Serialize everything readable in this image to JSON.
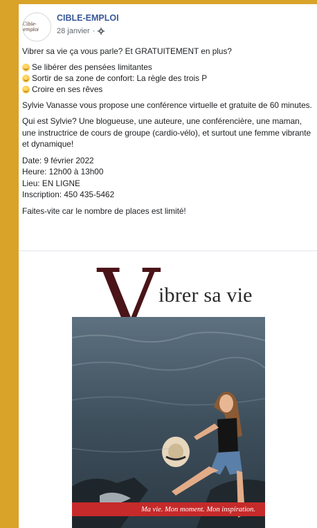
{
  "post": {
    "page_name": "CIBLE-EMPLOI",
    "avatar_text": "Cible-emploi",
    "date": "28 janvier",
    "separator": "·",
    "intro": "Vibrer sa vie ça vous parle? Et GRATUITEMENT en plus?",
    "bullets": [
      "Se libérer des pensées limitantes",
      "Sortir de sa zone de confort: La règle des trois P",
      "Croire en ses rêves"
    ],
    "para1": "Sylvie Vanasse vous propose une conférence virtuelle et gratuite de 60 minutes.",
    "para2": "Qui est Sylvie? Une blogueuse, une auteure, une conférencière, une maman, une instructrice de cours de groupe (cardio-vélo), et surtout une femme vibrante et dynamique!",
    "details": [
      "Date: 9 février 2022",
      "Heure: 12h00 à 13h00",
      "Lieu: EN LIGNE",
      "Inscription: 450 435-5462"
    ],
    "closing": "Faites-vite car le nombre de places est limité!"
  },
  "poster": {
    "title_initial": "V",
    "title_rest": "ibrer sa vie",
    "tagline": "Ma vie. Mon moment. Mon inspiration."
  },
  "icons": {
    "privacy": "gear-icon",
    "bullet": "smiling-face-emoji-icon"
  },
  "colors": {
    "background": "#d9a329",
    "page_name": "#385898",
    "title_v": "#4a1418",
    "tagline_band": "#c62a2a"
  }
}
